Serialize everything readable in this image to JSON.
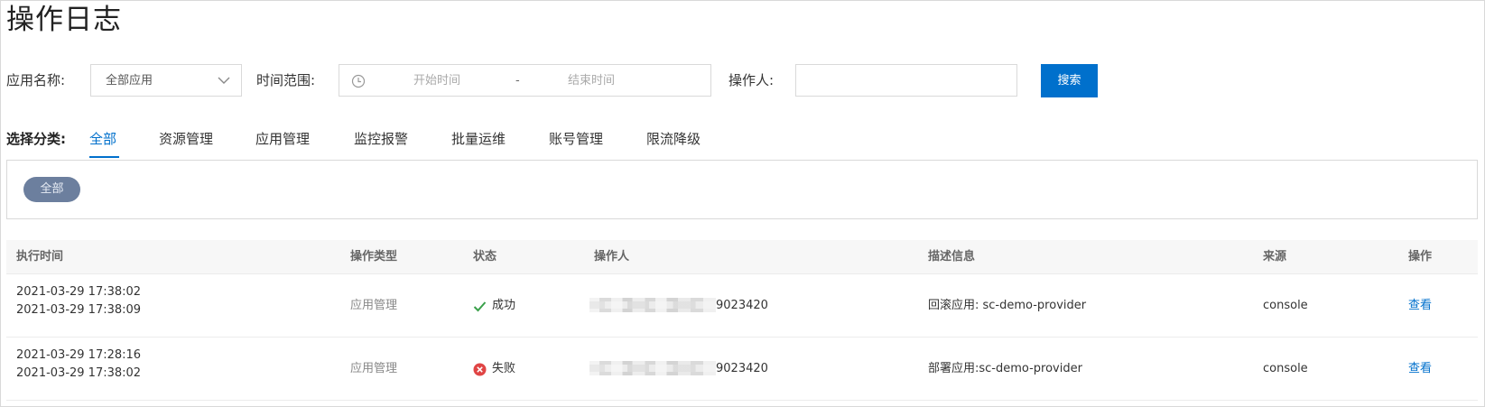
{
  "page": {
    "title": "操作日志"
  },
  "filters": {
    "app_label": "应用名称:",
    "app_value": "全部应用",
    "time_label": "时间范围:",
    "time_start_placeholder": "开始时间",
    "time_separator": "-",
    "time_end_placeholder": "结束时间",
    "operator_label": "操作人:",
    "operator_value": "",
    "search_button": "搜索"
  },
  "categories": {
    "label": "选择分类:",
    "tabs": [
      {
        "label": "全部",
        "active": true
      },
      {
        "label": "资源管理",
        "active": false
      },
      {
        "label": "应用管理",
        "active": false
      },
      {
        "label": "监控报警",
        "active": false
      },
      {
        "label": "批量运维",
        "active": false
      },
      {
        "label": "账号管理",
        "active": false
      },
      {
        "label": "限流降级",
        "active": false
      }
    ],
    "selected_pill": "全部"
  },
  "table": {
    "columns": [
      "执行时间",
      "操作类型",
      "状态",
      "操作人",
      "描述信息",
      "来源",
      "操作"
    ],
    "rows": [
      {
        "time_start": "2021-03-29 17:38:02",
        "time_end": "2021-03-29 17:38:09",
        "type": "应用管理",
        "status": "成功",
        "status_icon": "check-icon",
        "operator_suffix": "9023420",
        "description": "回滚应用: sc-demo-provider",
        "source": "console",
        "action": "查看"
      },
      {
        "time_start": "2021-03-29 17:28:16",
        "time_end": "2021-03-29 17:38:02",
        "type": "应用管理",
        "status": "失败",
        "status_icon": "error-circle-icon",
        "operator_suffix": "9023420",
        "description": "部署应用:sc-demo-provider",
        "source": "console",
        "action": "查看"
      }
    ]
  },
  "colors": {
    "accent": "#0070cc",
    "success": "#3aa04a",
    "error": "#e04545",
    "pill": "#6c7f9e"
  }
}
